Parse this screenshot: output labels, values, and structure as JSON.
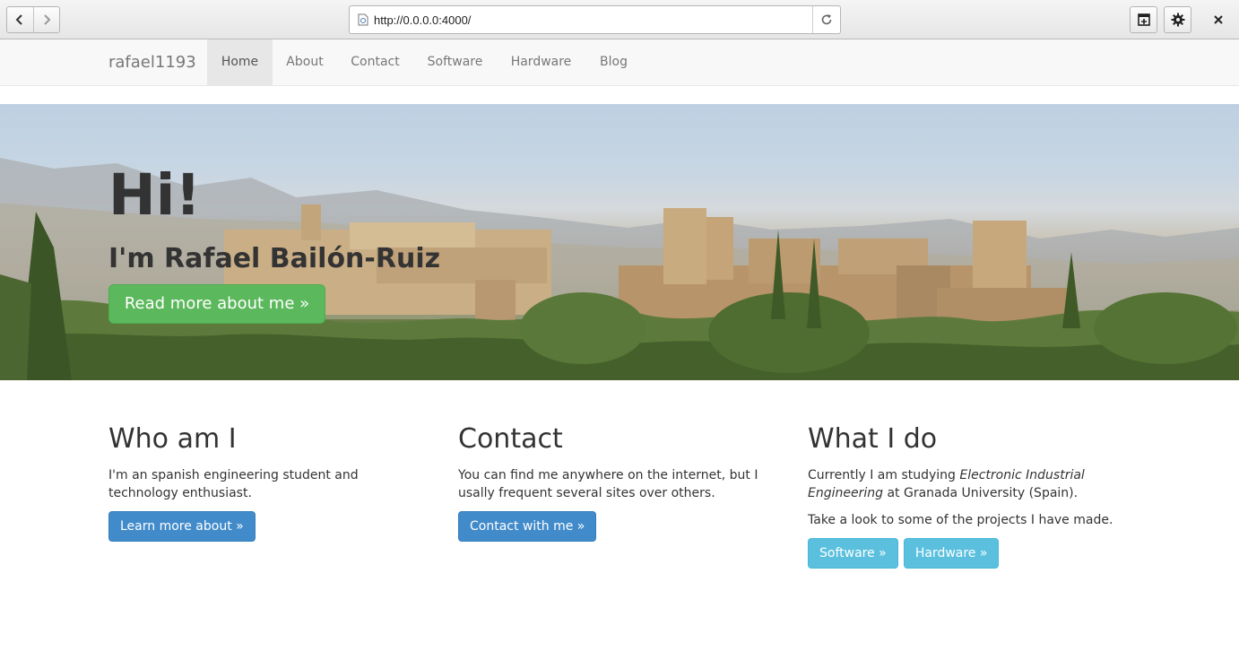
{
  "browser": {
    "url": "http://0.0.0.0:4000/",
    "back_icon": "chevron-left-icon",
    "forward_icon": "chevron-right-icon",
    "reload_icon": "reload-icon",
    "new_window_icon": "new-window-icon",
    "settings_icon": "gear-icon",
    "close_icon": "close-icon"
  },
  "navbar": {
    "brand": "rafael1193",
    "items": [
      {
        "label": "Home",
        "active": true
      },
      {
        "label": "About",
        "active": false
      },
      {
        "label": "Contact",
        "active": false
      },
      {
        "label": "Software",
        "active": false
      },
      {
        "label": "Hardware",
        "active": false
      },
      {
        "label": "Blog",
        "active": false
      }
    ]
  },
  "hero": {
    "title": "Hi!",
    "subtitle": "I'm Rafael Bailón-Ruiz",
    "button": "Read more about me »",
    "button_color": "#5cb85c"
  },
  "columns": [
    {
      "heading": "Who am I",
      "text": "I'm an spanish engineering student and technology enthusiast.",
      "buttons": [
        "Learn more about »"
      ]
    },
    {
      "heading": "Contact",
      "text": "You can find me anywhere on the internet, but I usally frequent several sites over others.",
      "buttons": [
        "Contact with me »"
      ]
    },
    {
      "heading": "What I do",
      "text_before": "Currently I am studying ",
      "text_emphasis": "Electronic Industrial Engineering",
      "text_after": " at Granada University (Spain).",
      "text2": "Take a look to some of the projects I have made.",
      "buttons": [
        "Software »",
        "Hardware »"
      ]
    }
  ],
  "colors": {
    "primary": "#428bca",
    "info": "#5bc0de",
    "navbar_bg": "#f8f8f8"
  }
}
